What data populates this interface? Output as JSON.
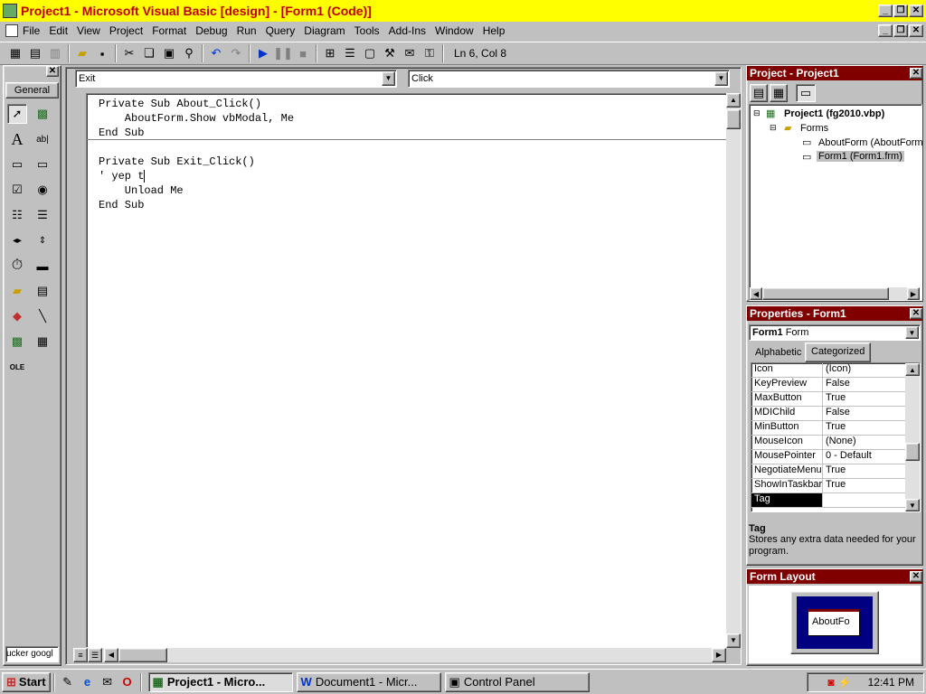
{
  "window": {
    "title": "Project1 - Microsoft Visual Basic [design] - [Form1 (Code)]"
  },
  "menu": [
    "File",
    "Edit",
    "View",
    "Project",
    "Format",
    "Debug",
    "Run",
    "Query",
    "Diagram",
    "Tools",
    "Add-Ins",
    "Window",
    "Help"
  ],
  "status": {
    "position": "Ln 6, Col 8"
  },
  "toolbox": {
    "tab": "General",
    "footer": "ucker googl"
  },
  "code": {
    "object_combo": "Exit",
    "proc_combo": "Click",
    "lines": [
      "Private Sub About_Click()",
      "    AboutForm.Show vbModal, Me",
      "End Sub",
      "Private Sub Exit_Click()",
      "' yep t",
      "    Unload Me",
      "End Sub"
    ]
  },
  "project": {
    "title": "Project - Project1",
    "root": "Project1 (fg2010.vbp)",
    "folder": "Forms",
    "items": [
      "AboutForm (AboutForm",
      "Form1 (Form1.frm)"
    ]
  },
  "properties": {
    "title": "Properties - Form1",
    "object_name": "Form1",
    "object_type": "Form",
    "tabs": [
      "Alphabetic",
      "Categorized"
    ],
    "rows": [
      {
        "name": "Icon",
        "value": "(Icon)"
      },
      {
        "name": "KeyPreview",
        "value": "False"
      },
      {
        "name": "MaxButton",
        "value": "True"
      },
      {
        "name": "MDIChild",
        "value": "False"
      },
      {
        "name": "MinButton",
        "value": "True"
      },
      {
        "name": "MouseIcon",
        "value": "(None)"
      },
      {
        "name": "MousePointer",
        "value": "0 - Default"
      },
      {
        "name": "NegotiateMenus",
        "value": "True"
      },
      {
        "name": "ShowInTaskbar",
        "value": "True"
      },
      {
        "name": "Tag",
        "value": ""
      }
    ],
    "desc_title": "Tag",
    "desc_text": "Stores any extra data needed for your program."
  },
  "layout": {
    "title": "Form Layout",
    "form_label": "AboutFo"
  },
  "taskbar": {
    "start": "Start",
    "buttons": [
      "Project1 - Micro...",
      "Document1 - Micr...",
      "Control Panel"
    ],
    "clock": "12:41 PM"
  }
}
